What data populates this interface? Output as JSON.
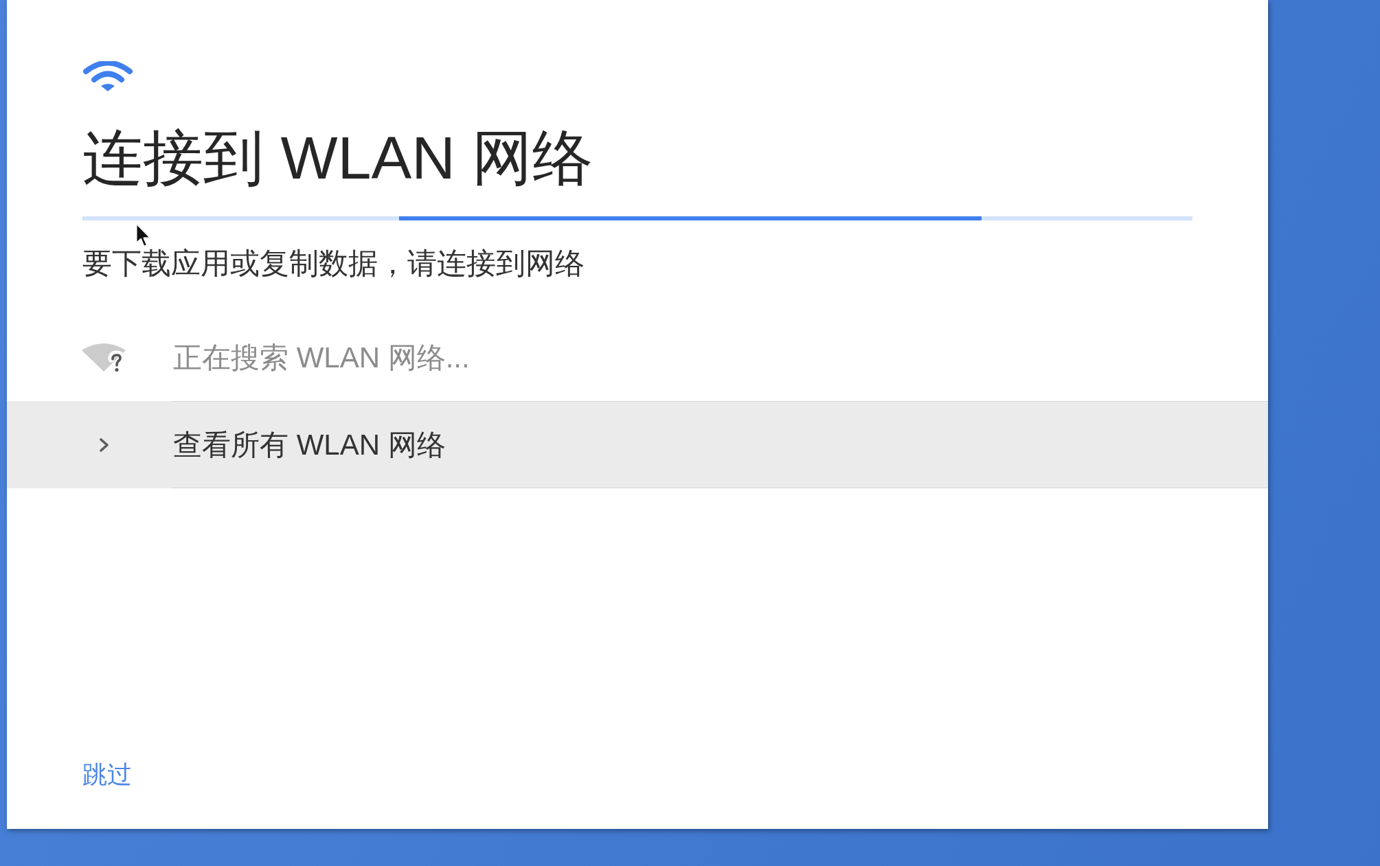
{
  "header": {
    "title": "连接到 WLAN 网络",
    "subtitle": "要下载应用或复制数据，请连接到网络"
  },
  "progress": {
    "indeterminate": true
  },
  "status": {
    "label": "正在搜索 WLAN 网络..."
  },
  "actions": [
    {
      "label": "查看所有 WLAN 网络",
      "highlighted": true
    }
  ],
  "skip_link": {
    "label": "跳过"
  }
}
